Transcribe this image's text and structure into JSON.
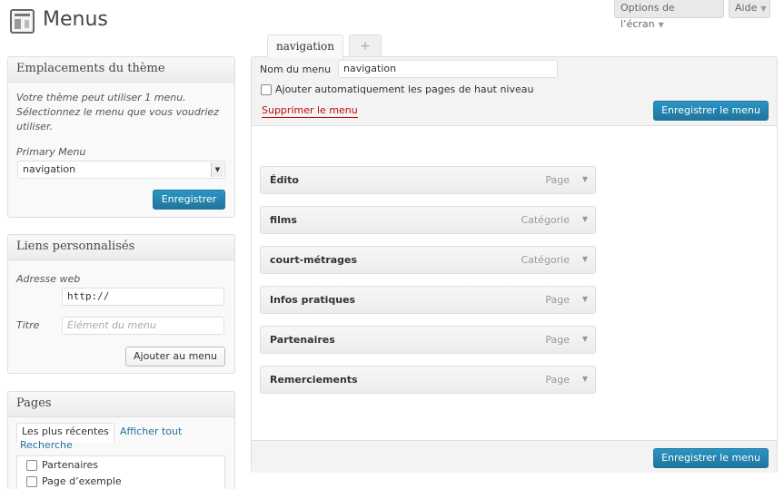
{
  "header": {
    "title": "Menus",
    "screen_options": "Options de l’écran",
    "help": "Aide",
    "dropdown_arrow": "▼"
  },
  "theme_locations": {
    "title": "Emplacements du thème",
    "description": "Votre thème peut utiliser 1 menu. Sélectionnez le menu que vous voudriez utiliser.",
    "primary_label": "Primary Menu",
    "primary_value": "navigation",
    "save_button": "Enregistrer"
  },
  "custom_links": {
    "title": "Liens personnalisés",
    "url_label": "Adresse web",
    "url_value": "http://",
    "title_label": "Titre",
    "title_placeholder": "Élément du menu",
    "add_button": "Ajouter au menu"
  },
  "pages_box": {
    "title": "Pages",
    "tabs": [
      "Les plus récentes",
      "Afficher tout",
      "Recherche"
    ],
    "items": [
      "Partenaires",
      "Page d’exemple"
    ]
  },
  "menu_tabs": {
    "active": "navigation",
    "add": "+"
  },
  "menu_editor": {
    "name_label": "Nom du menu",
    "name_value": "navigation",
    "auto_add_label": "Ajouter automatiquement les pages de haut niveau",
    "delete_link": "Supprimer le menu",
    "save_button": "Enregistrer le menu",
    "items": [
      {
        "title": "Édito",
        "type": "Page"
      },
      {
        "title": "films",
        "type": "Catégorie"
      },
      {
        "title": "court-métrages",
        "type": "Catégorie"
      },
      {
        "title": "Infos pratiques",
        "type": "Page"
      },
      {
        "title": "Partenaires",
        "type": "Page"
      },
      {
        "title": "Remerciements",
        "type": "Page"
      }
    ]
  },
  "colors": {
    "primary_button": "#21759b",
    "delete_link": "#bc0b0b",
    "link": "#21759b"
  }
}
